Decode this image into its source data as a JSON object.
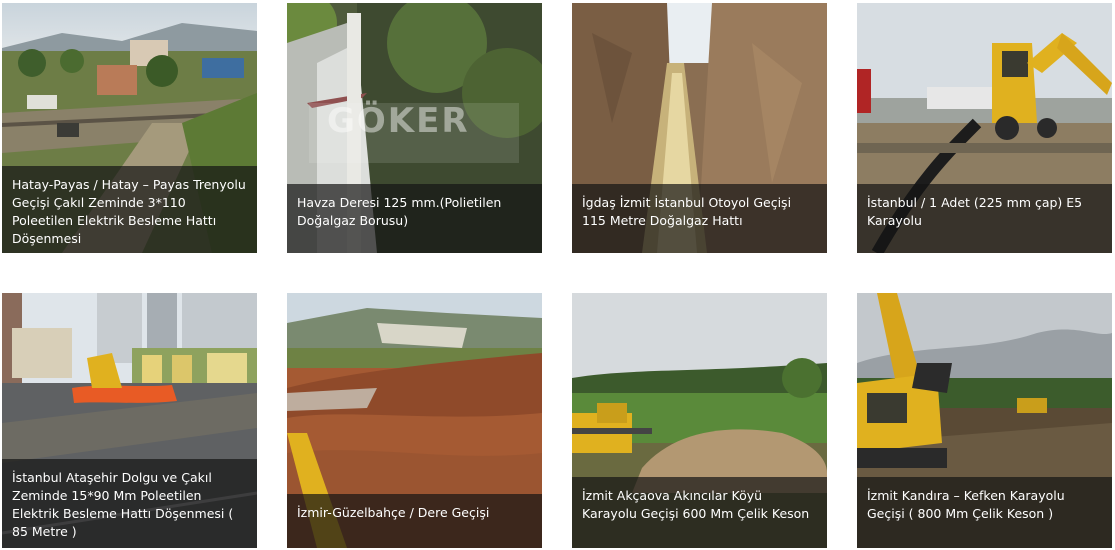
{
  "gallery": {
    "items": [
      {
        "caption": "Hatay-Payas / Hatay – Payas Trenyolu Geçişi Çakıl Zeminde 3*110 Poleetilen Elektrik Besleme Hattı Döşenmesi",
        "image": "railway-crossing-photo"
      },
      {
        "caption": "Havza Deresi 125 mm.(Polietilen Doğalgaz Borusu)",
        "image": "stream-pipe-photo",
        "watermark": "GÖKER"
      },
      {
        "caption": "İgdaş İzmit İstanbul Otoyol Geçişi 115 Metre Doğalgaz Hattı",
        "image": "trench-pipe-photo"
      },
      {
        "caption": "İstanbul / 1 Adet (225 mm çap) E5 Karayolu",
        "image": "backhoe-highway-photo"
      },
      {
        "caption": "İstanbul Ataşehir Dolgu ve Çakıl Zeminde 15*90 Mm Poleetilen Elektrik Besleme Hattı Döşenmesi ( 85 Metre )",
        "image": "urban-excavation-photo"
      },
      {
        "caption": "İzmir-Güzelbahçe / Dere Geçişi",
        "image": "excavated-field-photo"
      },
      {
        "caption": "İzmit Akçaova Akıncılar Köyü Karayolu Geçişi 600 Mm Çelik Keson",
        "image": "drilling-rig-photo"
      },
      {
        "caption": "İzmit Kandıra – Kefken Karayolu Geçişi ( 800 Mm Çelik Keson )",
        "image": "excavator-site-photo"
      }
    ]
  }
}
